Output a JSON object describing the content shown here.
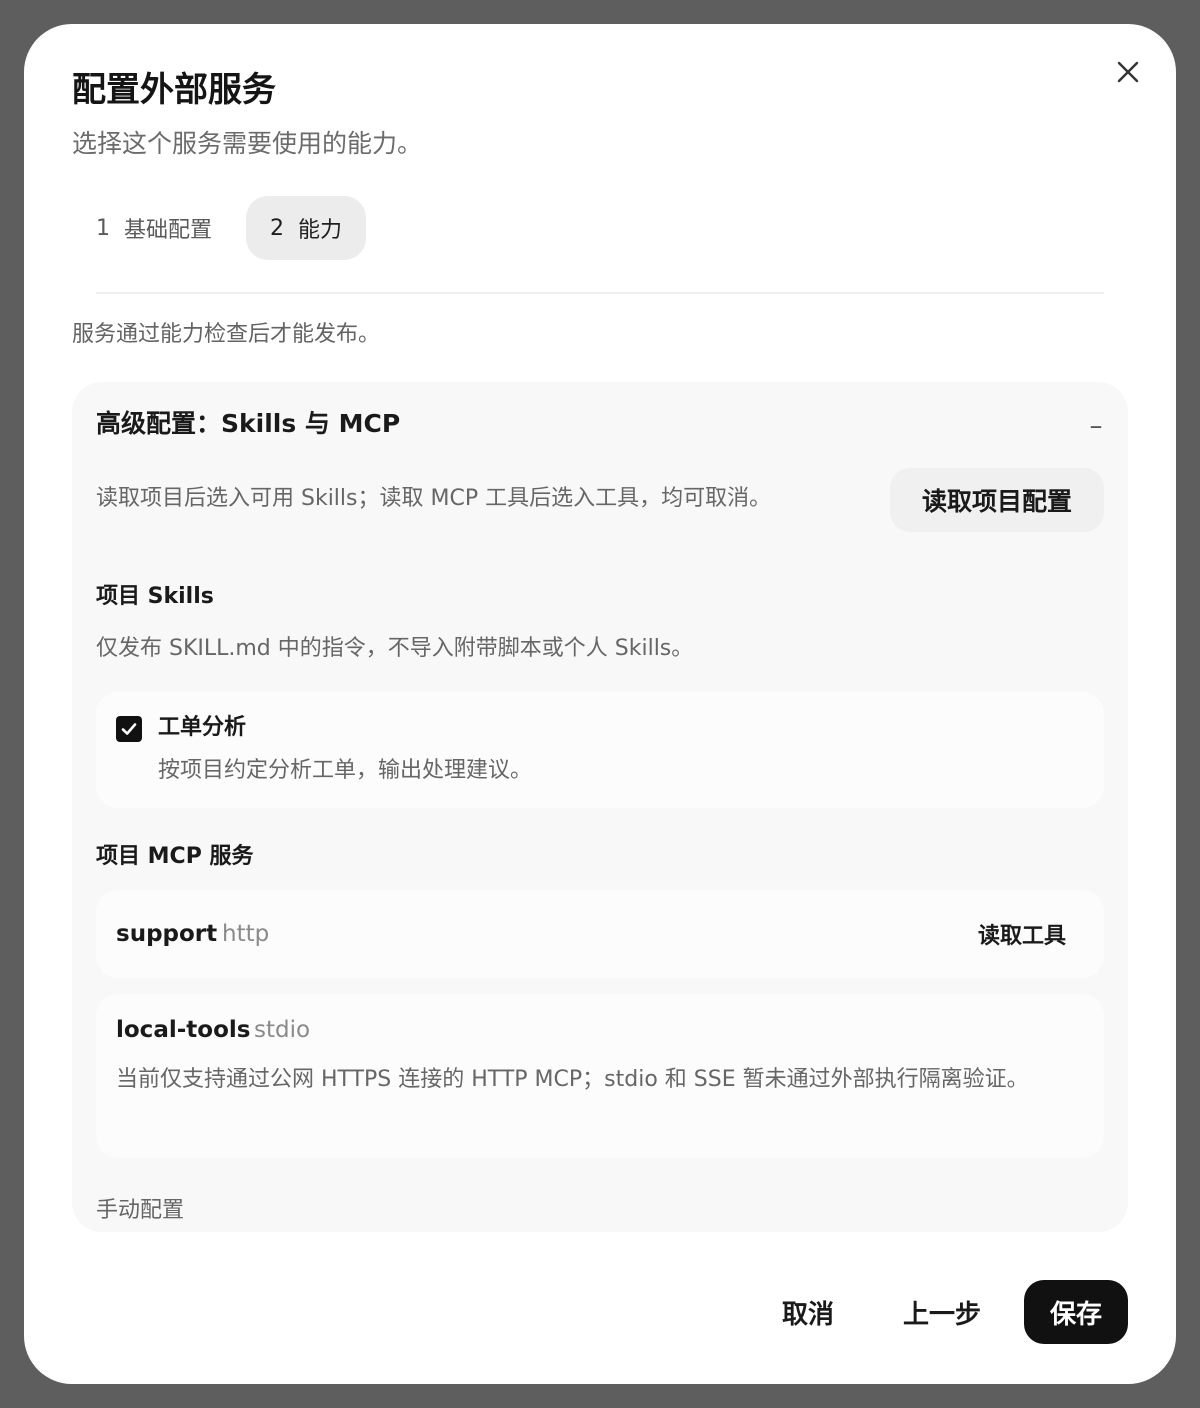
{
  "dialog": {
    "title": "配置外部服务",
    "subtitle": "选择这个服务需要使用的能力。",
    "close_icon": "close-icon"
  },
  "steps": [
    {
      "number": "1",
      "label": "基础配置",
      "active": false
    },
    {
      "number": "2",
      "label": "能力",
      "active": true
    }
  ],
  "notice": "服务通过能力检查后才能发布。",
  "advanced": {
    "title": "高级配置：Skills 与 MCP",
    "collapse_symbol": "–",
    "description": "读取项目后选入可用 Skills；读取 MCP 工具后选入工具，均可取消。",
    "read_project_button": "读取项目配置",
    "skills": {
      "title": "项目 Skills",
      "description": "仅发布 SKILL.md 中的指令，不导入附带脚本或个人 Skills。",
      "items": [
        {
          "name": "工单分析",
          "description": "按项目约定分析工单，输出处理建议。",
          "checked": true
        }
      ]
    },
    "mcp": {
      "title": "项目 MCP 服务",
      "servers": [
        {
          "name": "support",
          "type": "http",
          "action": "读取工具"
        },
        {
          "name": "local-tools",
          "type": "stdio",
          "warning": "当前仅支持通过公网 HTTPS 连接的 HTTP MCP；stdio 和 SSE 暂未通过外部执行隔离验证。"
        }
      ]
    },
    "manual_config": "手动配置"
  },
  "footer": {
    "cancel": "取消",
    "back": "上一步",
    "save": "保存"
  },
  "colors": {
    "primary_button": "#111111",
    "active_step_bg": "#ececec",
    "panel_bg": "#f8f8f8"
  }
}
